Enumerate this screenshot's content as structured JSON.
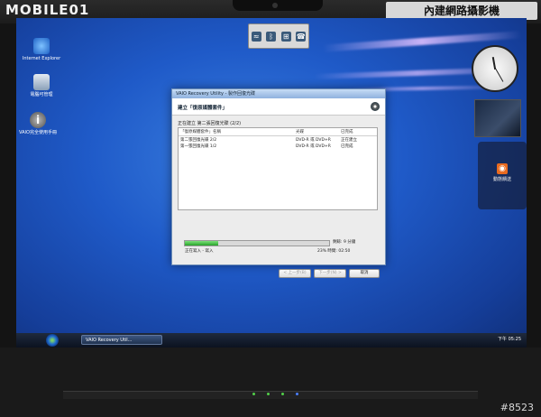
{
  "photo": {
    "brand": "MOBILE01",
    "watermark": "內建網路攝影機",
    "counter": "#8523"
  },
  "desktop": {
    "icons": [
      {
        "label": "Internet Explorer",
        "icon": "internet-explorer-icon"
      },
      {
        "label": "電腦可管理",
        "icon": "computer-icon"
      },
      {
        "label": "VAIO完全使用手冊",
        "icon": "info-icon"
      }
    ],
    "sidebar": {
      "feed_label": "動態饋送"
    }
  },
  "dialog": {
    "title": "VAIO Recovery Utility - 製作回復光碟",
    "header": "建立「復原媒體套件」",
    "status": "正在建立 第二張回復光碟 (2/2)",
    "columns": [
      "「復原媒體套件」名稱",
      "光碟",
      "已完成"
    ],
    "rows": [
      {
        "name": "第二張回復光碟 2/2",
        "media": "DVD-R 或 DVD+R",
        "state": "正在建立"
      },
      {
        "name": "第一張回復光碟 1/2",
        "media": "DVD-R 或 DVD+R",
        "state": "已完成"
      }
    ],
    "progress": 0.23,
    "remaining": "剩餘: 9 分鐘",
    "progress_status": "正在寫入 - 寫入",
    "elapsed": "23% 時間: 02:50",
    "buttons": {
      "back": "< 上一步(B)",
      "next": "下一步(N) >",
      "cancel": "取消"
    }
  },
  "taskbar": {
    "task": "VAIO Recovery Util...",
    "clock": "下午 05:25"
  }
}
